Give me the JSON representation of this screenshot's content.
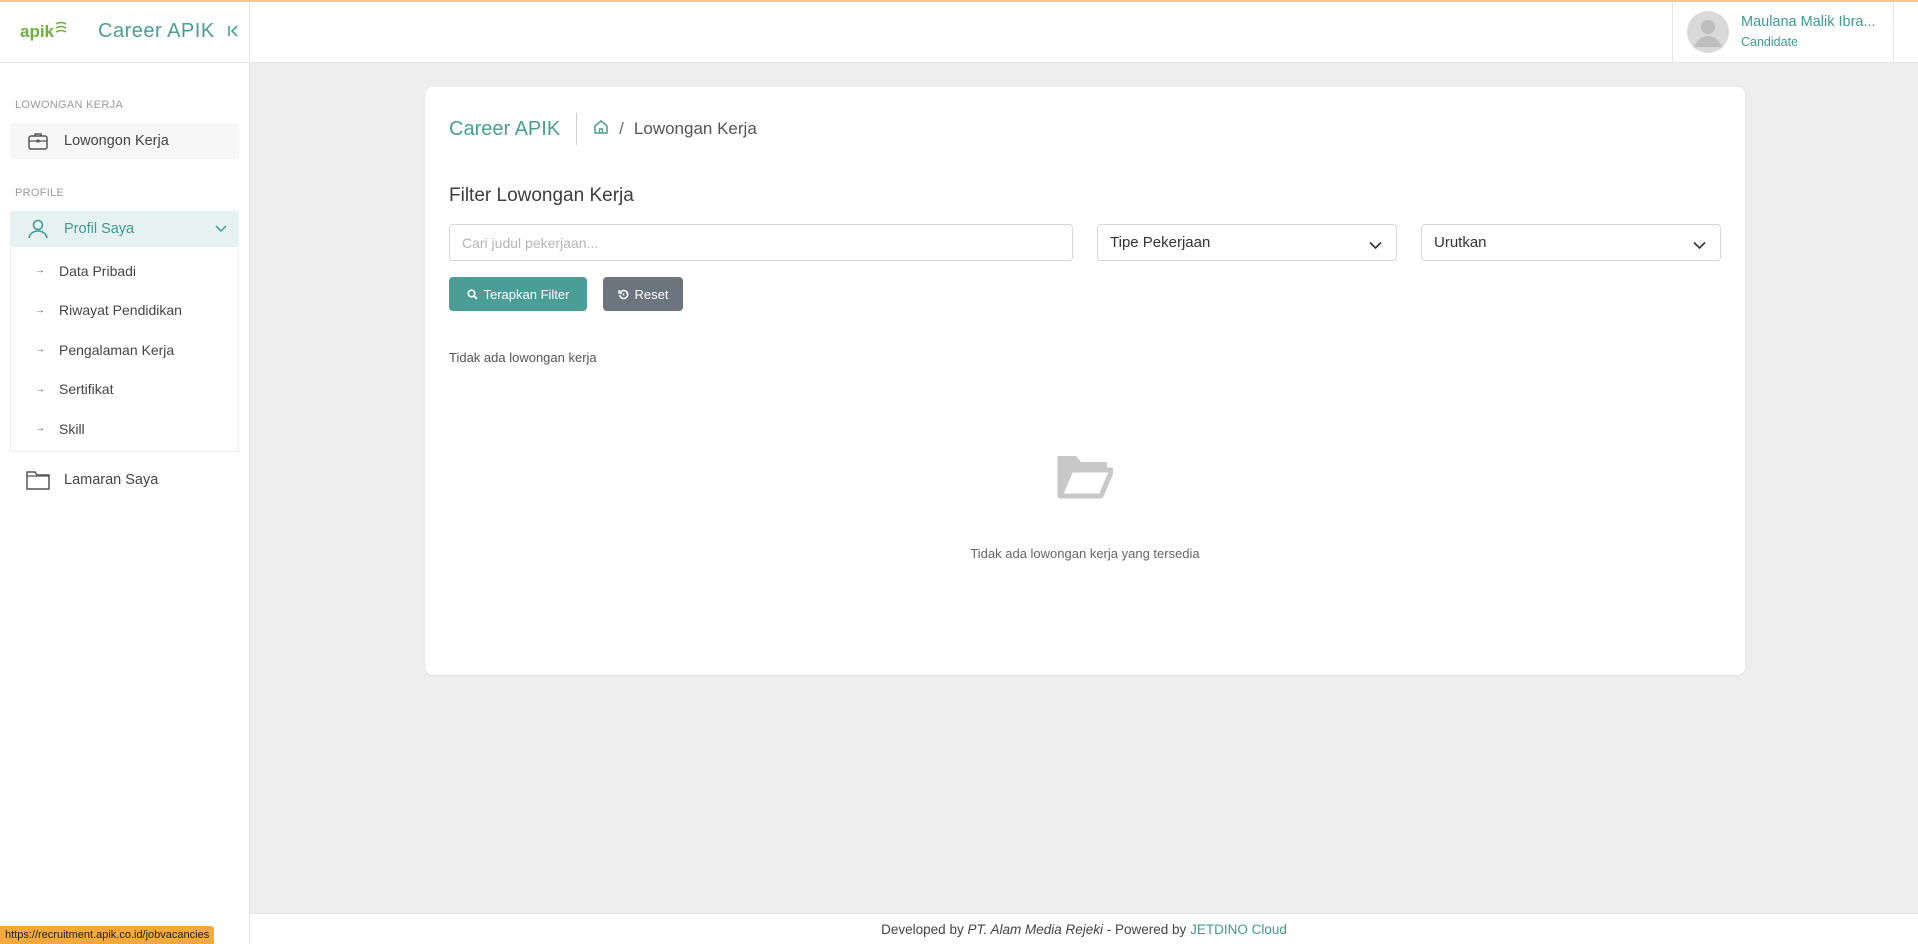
{
  "brand": {
    "logo_text": "apik",
    "title": "Career APIK"
  },
  "sidebar": {
    "sections": [
      {
        "label": "LOWONGAN KERJA"
      },
      {
        "label": "PROFILE"
      }
    ],
    "items": {
      "lowongan": "Lowongon Kerja",
      "profil": "Profil Saya",
      "lamaran": "Lamaran Saya"
    },
    "submenu": [
      {
        "label": "Data Pribadi"
      },
      {
        "label": "Riwayat Pendidikan"
      },
      {
        "label": "Pengalaman Kerja"
      },
      {
        "label": "Sertifikat"
      },
      {
        "label": "Skill"
      }
    ]
  },
  "user": {
    "name": "Maulana Malik Ibra...",
    "role": "Candidate"
  },
  "main": {
    "brand": "Career APIK",
    "breadcrumb": "Lowongan Kerja",
    "breadcrumb_sep": "/",
    "filter_title": "Filter Lowongan Kerja",
    "search_placeholder": "Cari judul pekerjaan...",
    "search_value": "",
    "tipe_select": "Tipe Pekerjaan",
    "urut_select": "Urutkan",
    "apply_label": "Terapkan Filter",
    "reset_label": "Reset",
    "no_jobs": "Tidak ada lowongan kerja",
    "empty_message": "Tidak ada lowongan kerja yang tersedia"
  },
  "footer": {
    "prefix": "Developed by ",
    "company": "PT. Alam Media Rejeki",
    "middle": " - Powered by ",
    "powered": "JETDINO Cloud"
  },
  "status_url": "https://recruitment.apik.co.id/jobvacancies",
  "colors": {
    "accent": "#4a9e96",
    "reset_button": "#6c757d",
    "background": "#eeeeee",
    "status_bar": "#f5a93a"
  }
}
